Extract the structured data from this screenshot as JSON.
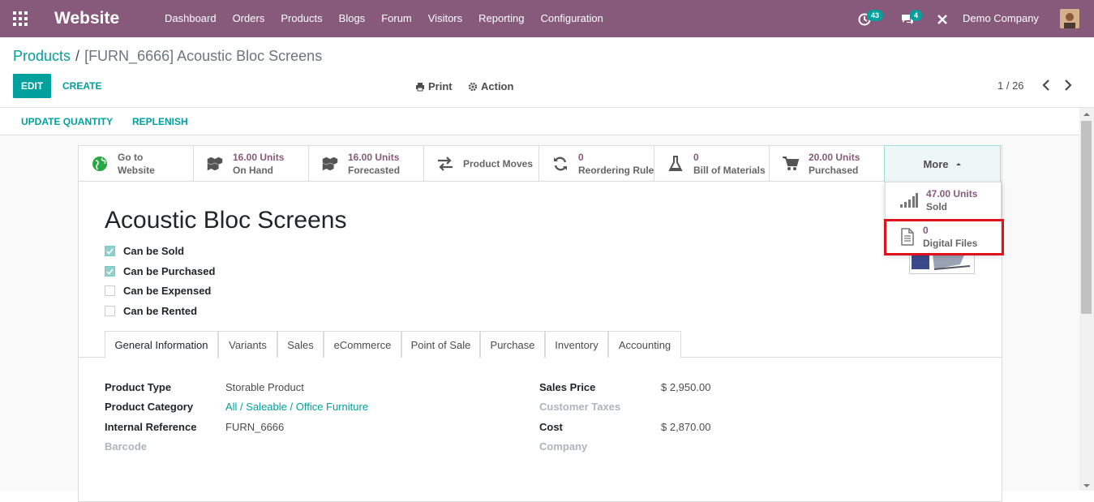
{
  "app": {
    "name": "Website"
  },
  "nav": {
    "items": [
      "Dashboard",
      "Orders",
      "Products",
      "Blogs",
      "Forum",
      "Visitors",
      "Reporting",
      "Configuration"
    ]
  },
  "systray": {
    "activity_count": "43",
    "messages_count": "4",
    "company": "Demo Company"
  },
  "breadcrumb": {
    "parent": "Products",
    "separator": "/",
    "current": "[FURN_6666] Acoustic Bloc Screens"
  },
  "control": {
    "edit_label": "EDIT",
    "create_label": "CREATE",
    "print_label": "Print",
    "action_label": "Action",
    "pager": "1 / 26"
  },
  "status_bar": {
    "update_quantity": "UPDATE QUANTITY",
    "replenish": "REPLENISH"
  },
  "smart_buttons": [
    {
      "icon": "globe-icon",
      "value": "Go to",
      "label": "Website",
      "muted_value": true
    },
    {
      "icon": "cubes-icon",
      "value": "16.00 Units",
      "label": "On Hand"
    },
    {
      "icon": "cubes-icon",
      "value": "16.00 Units",
      "label": "Forecasted"
    },
    {
      "icon": "exchange-icon",
      "value": "",
      "label": "Product Moves"
    },
    {
      "icon": "refresh-icon",
      "value": "0",
      "label": "Reordering Rules"
    },
    {
      "icon": "flask-icon",
      "value": "0",
      "label": "Bill of Materials"
    },
    {
      "icon": "cart-icon",
      "value": "20.00 Units",
      "label": "Purchased"
    }
  ],
  "more": {
    "label": "More"
  },
  "dropdown": [
    {
      "icon": "signal-icon",
      "value": "47.00 Units",
      "label": "Sold"
    },
    {
      "icon": "file-icon",
      "value": "0",
      "label": "Digital Files"
    }
  ],
  "product": {
    "name": "Acoustic Bloc Screens",
    "checkboxes": [
      {
        "label": "Can be Sold",
        "checked": true
      },
      {
        "label": "Can be Purchased",
        "checked": true
      },
      {
        "label": "Can be Expensed",
        "checked": false
      },
      {
        "label": "Can be Rented",
        "checked": false
      }
    ]
  },
  "tabs": [
    "General Information",
    "Variants",
    "Sales",
    "eCommerce",
    "Point of Sale",
    "Purchase",
    "Inventory",
    "Accounting"
  ],
  "fields": {
    "left": [
      {
        "label": "Product Type",
        "value": "Storable Product"
      },
      {
        "label": "Product Category",
        "value": "All / Saleable / Office Furniture"
      },
      {
        "label": "Internal Reference",
        "value": "FURN_6666"
      },
      {
        "label": "Barcode",
        "value": ""
      }
    ],
    "right": [
      {
        "label": "Sales Price",
        "value": "$ 2,950.00"
      },
      {
        "label": "Customer Taxes",
        "value": ""
      },
      {
        "label": "Cost",
        "value": "$ 2,870.00"
      },
      {
        "label": "Company",
        "value": ""
      }
    ]
  },
  "colors": {
    "brand": "#875a7b",
    "accent": "#00a09d",
    "highlight": "#e0111b"
  }
}
